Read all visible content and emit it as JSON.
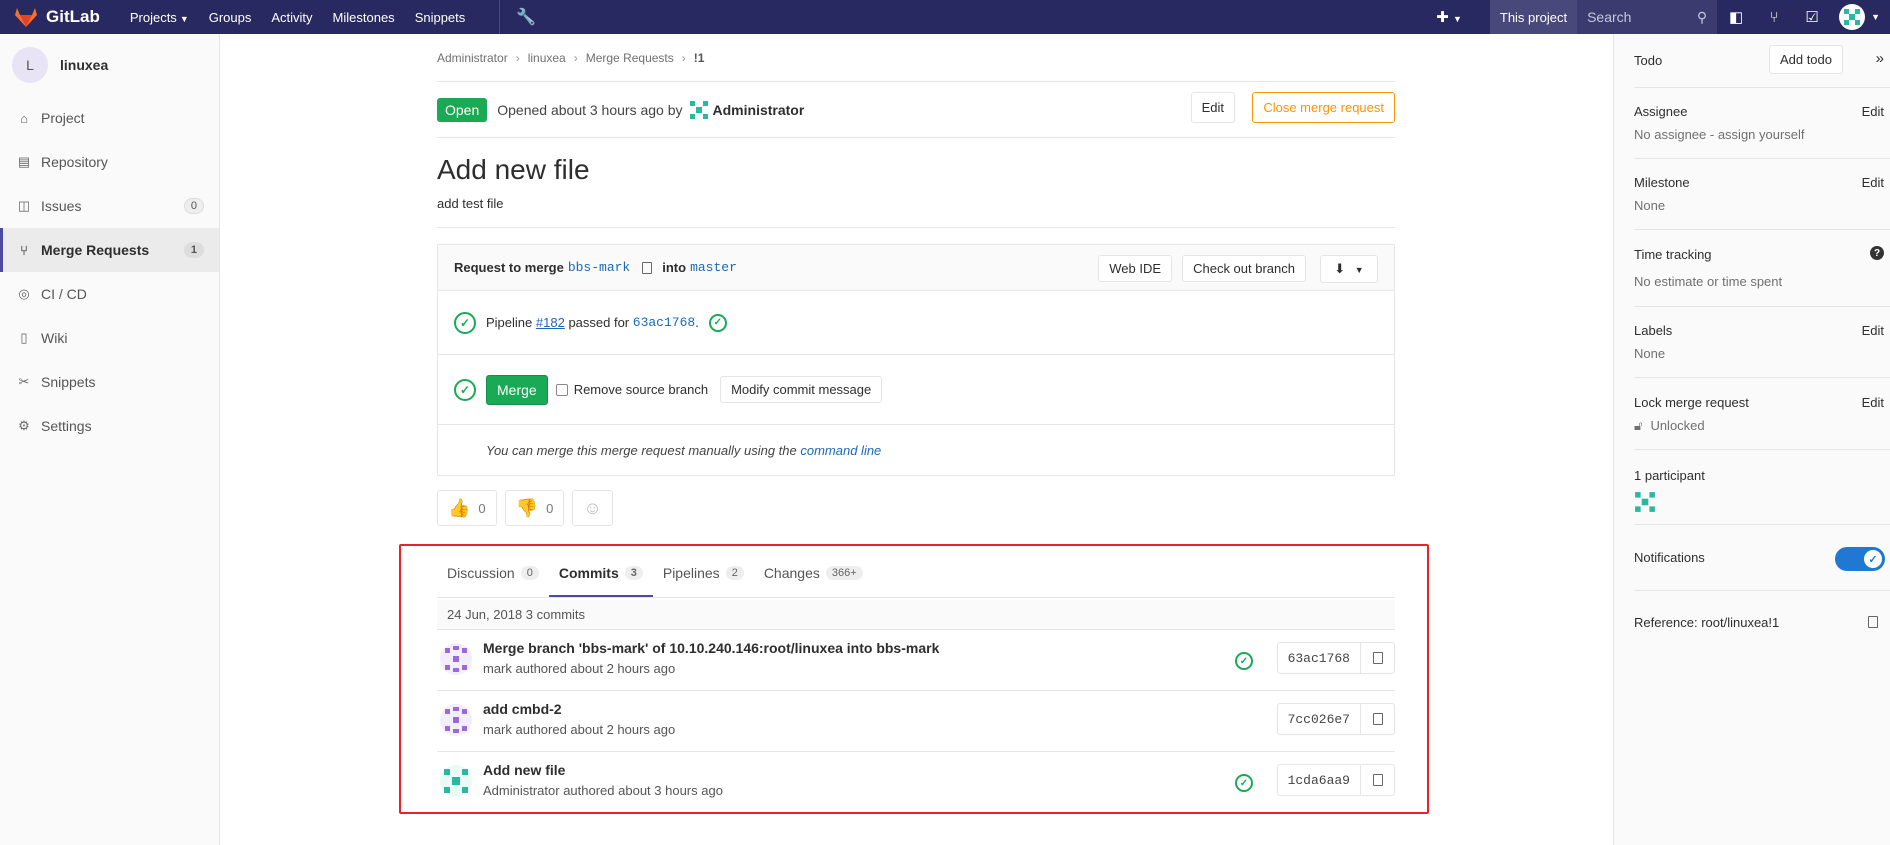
{
  "topnav": {
    "brand": "GitLab",
    "links": [
      "Projects",
      "Groups",
      "Activity",
      "Milestones",
      "Snippets"
    ],
    "scope": "This project",
    "search_placeholder": "Search"
  },
  "sidebar": {
    "project_initial": "L",
    "project_name": "linuxea",
    "items": [
      {
        "label": "Project",
        "icon": "home-icon"
      },
      {
        "label": "Repository",
        "icon": "book-icon"
      },
      {
        "label": "Issues",
        "icon": "issues-icon",
        "count": "0"
      },
      {
        "label": "Merge Requests",
        "icon": "merge-request-icon",
        "count": "1",
        "active": true
      },
      {
        "label": "CI / CD",
        "icon": "rocket-icon"
      },
      {
        "label": "Wiki",
        "icon": "wiki-icon"
      },
      {
        "label": "Snippets",
        "icon": "scissors-icon"
      },
      {
        "label": "Settings",
        "icon": "gear-icon"
      }
    ]
  },
  "breadcrumb": [
    "Administrator",
    "linuxea",
    "Merge Requests",
    "!1"
  ],
  "mr": {
    "status": "Open",
    "opened_text": "Opened about 3 hours ago by",
    "author": "Administrator",
    "edit_label": "Edit",
    "close_label": "Close merge request",
    "title": "Add new file",
    "description": "add test file"
  },
  "widget": {
    "request_prefix": "Request to merge",
    "source_branch": "bbs-mark",
    "into": "into",
    "target_branch": "master",
    "web_ide": "Web IDE",
    "checkout": "Check out branch",
    "pipeline_prefix": "Pipeline",
    "pipeline_id": "#182",
    "pipeline_mid": "passed for",
    "pipeline_sha": "63ac1768",
    "merge_label": "Merge",
    "remove_source": "Remove source branch",
    "modify_commit": "Modify commit message",
    "hint_prefix": "You can merge this merge request manually using the",
    "hint_link": "command line"
  },
  "awards": {
    "thumbs_up": "0",
    "thumbs_down": "0"
  },
  "tabs": [
    {
      "label": "Discussion",
      "count": "0"
    },
    {
      "label": "Commits",
      "count": "3",
      "active": true
    },
    {
      "label": "Pipelines",
      "count": "2"
    },
    {
      "label": "Changes",
      "count": "366+"
    }
  ],
  "commits": {
    "day_header": "24 Jun, 2018 3 commits",
    "items": [
      {
        "title": "Merge branch 'bbs-mark' of 10.10.240.146:root/linuxea into bbs-mark",
        "meta": "mark authored about 2 hours ago",
        "sha": "63ac1768",
        "passed": true
      },
      {
        "title": "add cmbd-2",
        "meta": "mark authored about 2 hours ago",
        "sha": "7cc026e7",
        "passed": false
      },
      {
        "title": "Add new file",
        "meta": "Administrator authored about 3 hours ago",
        "sha": "1cda6aa9",
        "passed": true
      }
    ]
  },
  "right_sidebar": {
    "todo_label": "Todo",
    "add_todo": "Add todo",
    "assignee_label": "Assignee",
    "assignee_value": "No assignee - assign yourself",
    "milestone_label": "Milestone",
    "milestone_value": "None",
    "time_label": "Time tracking",
    "time_value": "No estimate or time spent",
    "labels_label": "Labels",
    "labels_value": "None",
    "lock_label": "Lock merge request",
    "lock_value": "Unlocked",
    "participants": "1 participant",
    "notifications": "Notifications",
    "reference": "Reference: root/linuxea!1",
    "edit": "Edit"
  },
  "colors": {
    "nav": "#292961",
    "success": "#1aaa55",
    "link": "#1b69b6",
    "warning": "#fc9403",
    "highlight": "#e8242a"
  }
}
